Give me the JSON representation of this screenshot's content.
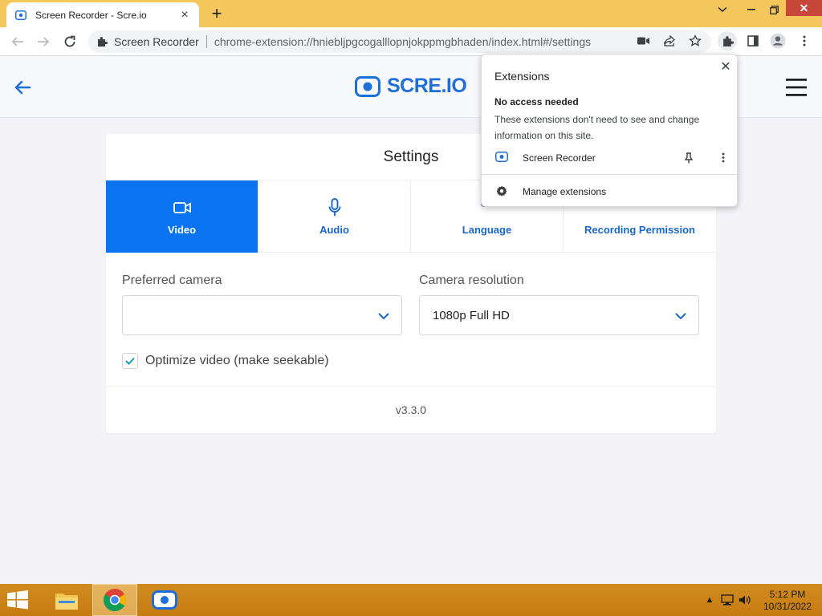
{
  "browser": {
    "tab_title": "Screen Recorder - Scre.io",
    "omnibox": {
      "site_name": "Screen Recorder",
      "url": "chrome-extension://hniebljpgcogalllopnjokppmgbhaden/index.html#/settings"
    }
  },
  "app": {
    "logo_text": "SCRE.IO",
    "brand_color": "#1e6fd9"
  },
  "settings": {
    "title": "Settings",
    "tabs": [
      {
        "label": "Video",
        "icon": "camera-icon",
        "active": true
      },
      {
        "label": "Audio",
        "icon": "microphone-icon",
        "active": false
      },
      {
        "label": "Language",
        "icon": "language-icon",
        "active": false
      },
      {
        "label": "Recording Permission",
        "icon": "permission-icon",
        "active": false
      }
    ],
    "preferred_camera": {
      "label": "Preferred camera",
      "value": ""
    },
    "camera_resolution": {
      "label": "Camera resolution",
      "value": "1080p Full HD"
    },
    "optimize_video": {
      "label": "Optimize video (make seekable)",
      "checked": true
    },
    "version": "v3.3.0",
    "active_tab_color": "#0a74f0"
  },
  "extensions_popup": {
    "title": "Extensions",
    "heading": "No access needed",
    "description": "These extensions don't need to see and change information on this site.",
    "item_label": "Screen Recorder",
    "manage_label": "Manage extensions"
  },
  "taskbar": {
    "time": "5:12 PM",
    "date": "10/31/2022"
  }
}
